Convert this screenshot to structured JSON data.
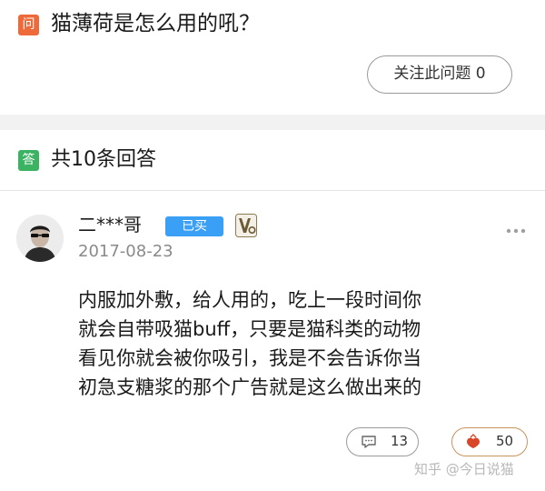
{
  "question": {
    "badge": "问",
    "title": "猫薄荷是怎么用的吼？",
    "follow_label": "关注此问题 0"
  },
  "answers_header": {
    "badge": "答",
    "count_label": "共10条回答"
  },
  "answer": {
    "author": "二***哥",
    "bought_badge": "已买",
    "date": "2017-08-23",
    "text_lines": [
      "内服加外敷，给人用的，吃上一段时间你",
      "就会自带吸猫buff，只要是猫科类的动物",
      "看见你就会被你吸引，我是不会告诉你当",
      "初急支糖浆的那个广告就是这么做出来的"
    ],
    "comment_count": "13",
    "like_count": "50"
  },
  "watermark": "知乎 @今日说猫",
  "colors": {
    "question_badge": "#ee6a3a",
    "answer_badge": "#3cb363",
    "bought_badge": "#3aa0f5",
    "like_border": "#c9935e",
    "like_icon": "#d9472b"
  }
}
